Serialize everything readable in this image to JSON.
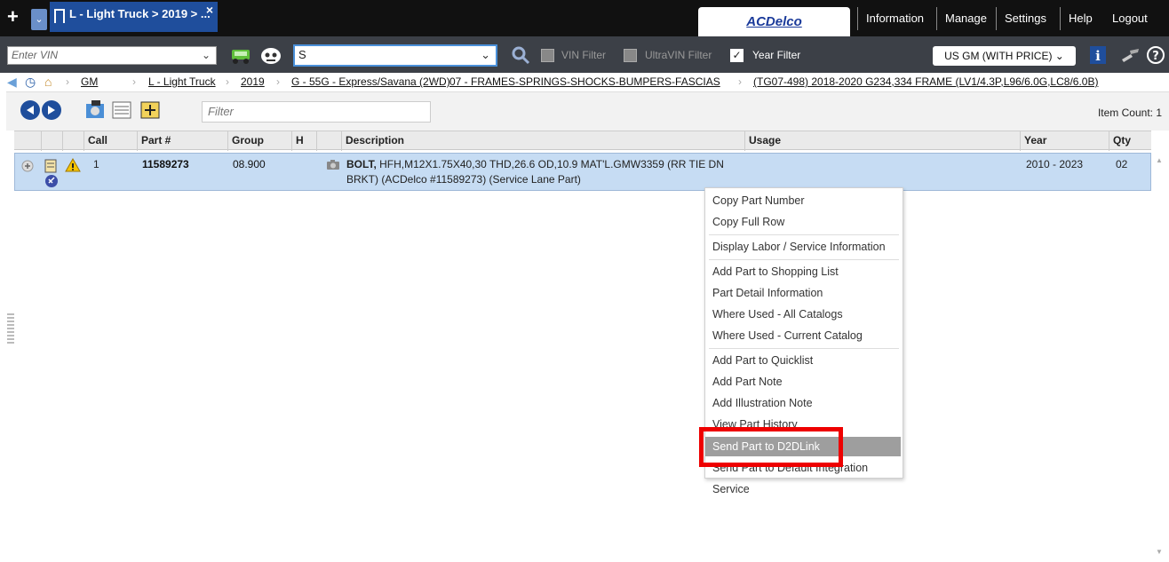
{
  "topbar": {
    "tab_title": "L - Light Truck > 2019 > ...",
    "brand": "ACDelco",
    "nav": [
      "Information",
      "Manage",
      "Settings",
      "Help",
      "Logout"
    ]
  },
  "toolbar": {
    "vin_placeholder": "Enter VIN",
    "search_value": "S",
    "vin_filter": "VIN Filter",
    "ultravin_filter": "UltraVIN Filter",
    "year_filter": "Year Filter",
    "price_select": "US GM (WITH PRICE)"
  },
  "breadcrumb": [
    "GM",
    "L - Light Truck",
    "2019",
    "G - 55G - Express/Savana (2WD)",
    "07 - FRAMES-SPRINGS-SHOCKS-BUMPERS-FASCIAS",
    "(TG07-498)  2018-2020  G234,334  FRAME (LV1/4.3P,L96/6.0G,LC8/6.0B)"
  ],
  "gridbar": {
    "filter_placeholder": "Filter",
    "item_count": "Item Count: 1"
  },
  "table": {
    "columns": [
      "Call",
      "Part #",
      "Group",
      "H",
      "Description",
      "Usage",
      "Year",
      "Qty"
    ],
    "rows": [
      {
        "call": "1",
        "part": "11589273",
        "group": "08.900",
        "desc_bold": "BOLT,",
        "desc_line1": " HFH,M12X1.75X40,30 THD,26.6 OD,10.9 MAT'L.GMW3359 (RR TIE DN",
        "desc_line2": "BRKT) (ACDelco #11589273) (Service Lane Part)",
        "usage": "",
        "year": "2010 - 2023",
        "qty": "02"
      }
    ]
  },
  "context_menu": {
    "items": [
      "Copy Part Number",
      "Copy Full Row",
      "Display Labor / Service Information",
      "Add Part to Shopping List",
      "Part Detail Information",
      "Where Used - All Catalogs",
      "Where Used - Current Catalog",
      "Add Part to Quicklist",
      "Add Part Note",
      "Add Illustration Note",
      "View Part History",
      "Send Part to D2DLink",
      "Send Part to Default Integration Service"
    ],
    "highlighted": "Send Part to D2DLink"
  }
}
